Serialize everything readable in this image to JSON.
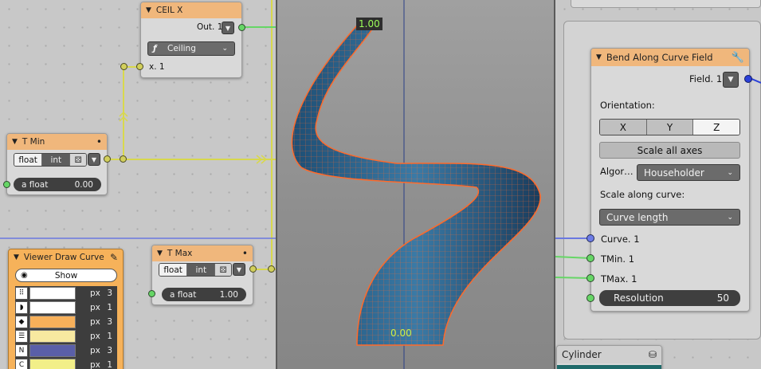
{
  "ceil_node": {
    "title": "CEIL X",
    "output": "Out. 1",
    "mode": "Ceiling",
    "input": "x. 1"
  },
  "tmin_node": {
    "title": "T Min",
    "type_float": "float",
    "type_int": "int",
    "field_label": "a float",
    "field_value": "0.00"
  },
  "tmax_node": {
    "title": "T Max",
    "type_float": "float",
    "type_int": "int",
    "field_label": "a float",
    "field_value": "1.00"
  },
  "viewer_node": {
    "title": "Viewer Draw Curve",
    "show_label": "Show",
    "rows": [
      {
        "unit": "px",
        "num": "3",
        "swatch": "#ffffff",
        "icon": "dots"
      },
      {
        "unit": "px",
        "num": "1",
        "swatch": "#ffffff",
        "icon": "D"
      },
      {
        "unit": "px",
        "num": "3",
        "swatch": "#f7b05a",
        "icon": "diamond"
      },
      {
        "unit": "px",
        "num": "1",
        "swatch": "#f7e9a0",
        "icon": "bars"
      },
      {
        "unit": "px",
        "num": "3",
        "swatch": "#5a5fa8",
        "icon": "N"
      },
      {
        "unit": "px",
        "num": "1",
        "swatch": "#f2ef88",
        "icon": "C"
      }
    ]
  },
  "viewport": {
    "top_label": "1.00",
    "bottom_label": "0.00"
  },
  "bend_node": {
    "title": "Bend Along Curve Field",
    "output": "Field. 1",
    "orientation_label": "Orientation:",
    "axes": [
      "X",
      "Y",
      "Z"
    ],
    "selected_axis": "Z",
    "scale_all_label": "Scale all axes",
    "algor_label": "Algor…",
    "algor_value": "Householder",
    "scale_along_label": "Scale along curve:",
    "scale_along_value": "Curve length",
    "inputs": [
      "Curve. 1",
      "TMin. 1",
      "TMax. 1"
    ],
    "resolution_label": "Resolution",
    "resolution_value": "50"
  },
  "cylinder_node": {
    "title": "Cylinder"
  },
  "colors": {
    "node_header": "#f0b77c",
    "socket_green": "#66d666",
    "socket_yellow": "#d2cf5c",
    "socket_blue": "#6d7ce6",
    "mesh_orange": "#ff6a2a",
    "mesh_blue": "#2d5f86"
  }
}
